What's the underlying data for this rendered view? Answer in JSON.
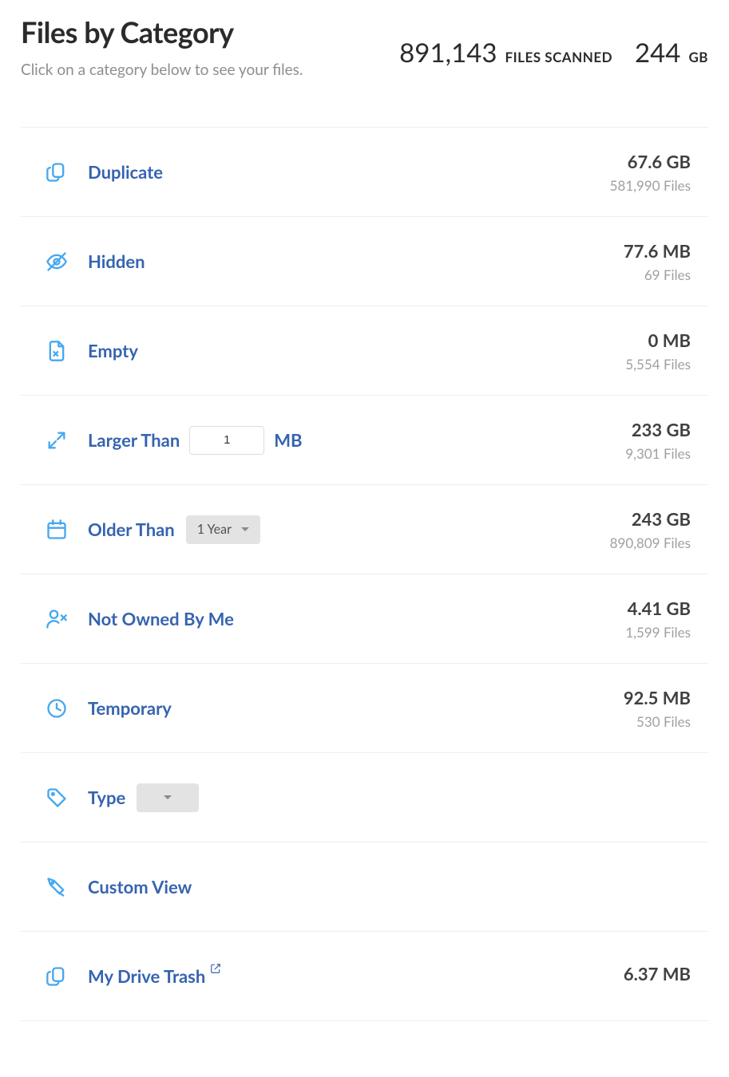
{
  "header": {
    "title": "Files by Category",
    "subtitle": "Click on a category below to see your files.",
    "files_scanned_value": "891,143",
    "files_scanned_label": "FILES SCANNED",
    "total_size_value": "244",
    "total_size_unit": "GB"
  },
  "categories": {
    "duplicate": {
      "label": "Duplicate",
      "size": "67.6 GB",
      "files": "581,990 Files"
    },
    "hidden": {
      "label": "Hidden",
      "size": "77.6 MB",
      "files": "69 Files"
    },
    "empty": {
      "label": "Empty",
      "size": "0 MB",
      "files": "5,554 Files"
    },
    "larger_than": {
      "label": "Larger Than",
      "size": "233 GB",
      "files": "9,301 Files",
      "input_value": "1",
      "unit": "MB"
    },
    "older_than": {
      "label": "Older Than",
      "size": "243 GB",
      "files": "890,809 Files",
      "select_value": "1 Year"
    },
    "not_owned": {
      "label": "Not Owned By Me",
      "size": "4.41 GB",
      "files": "1,599 Files"
    },
    "temporary": {
      "label": "Temporary",
      "size": "92.5 MB",
      "files": "530 Files"
    },
    "type": {
      "label": "Type",
      "select_value": ""
    },
    "custom_view": {
      "label": "Custom View"
    },
    "my_drive_trash": {
      "label": "My Drive Trash",
      "size": "6.37 MB"
    }
  }
}
